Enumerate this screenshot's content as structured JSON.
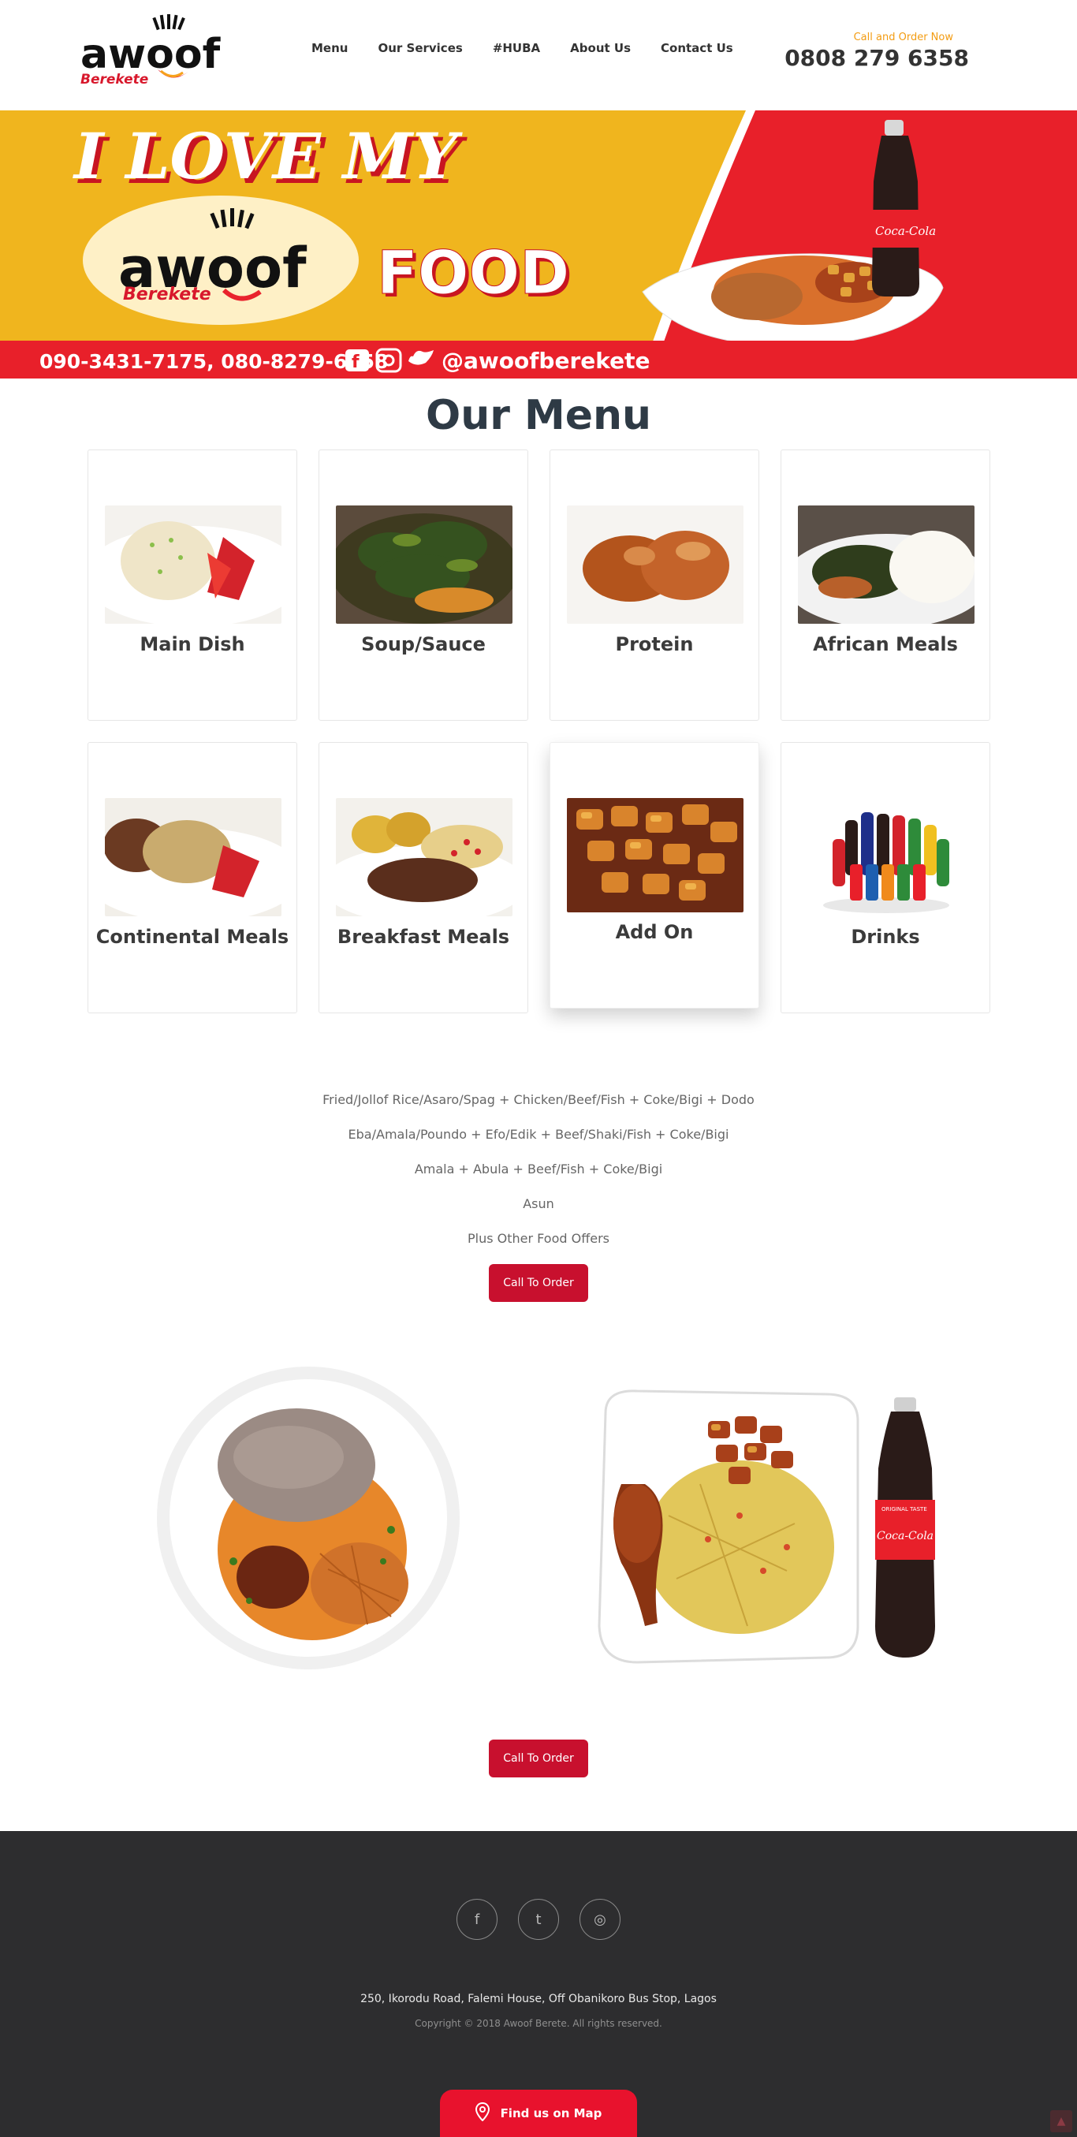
{
  "header": {
    "logo_text": "awoof",
    "logo_subtext": "Berekete",
    "nav": [
      "Menu",
      "Our Services",
      "#HUBA",
      "About Us",
      "Contact Us"
    ],
    "call_label": "Call and Order Now",
    "call_number": "0808 279 6358"
  },
  "banner": {
    "headline": "I LOVE MY",
    "logo_text": "awoof",
    "logo_subtext": "Berekete",
    "food_word": "FOOD",
    "phones": "090-3431-7175, 080-8279-6358",
    "handle": "@awoofberekete",
    "bottle_brand": "Coca-Cola",
    "colors": {
      "yellow": "#f0b51e",
      "red": "#e8202a",
      "white": "#ffffff"
    }
  },
  "menu": {
    "title": "Our Menu",
    "items": [
      {
        "label": "Main Dish",
        "icon": "rice-plate-photo"
      },
      {
        "label": "Soup/Sauce",
        "icon": "vegetable-soup-photo"
      },
      {
        "label": "Protein",
        "icon": "fried-chicken-photo"
      },
      {
        "label": "African Meals",
        "icon": "swallow-soup-photo"
      },
      {
        "label": "Continental Meals",
        "icon": "fried-rice-chicken-photo"
      },
      {
        "label": "Breakfast Meals",
        "icon": "yam-egg-photo"
      },
      {
        "label": "Add On",
        "icon": "dodo-photo"
      },
      {
        "label": "Drinks",
        "icon": "soft-drinks-photo"
      }
    ]
  },
  "offers": {
    "lines": [
      "Fried/Jollof Rice/Asaro/Spag + Chicken/Beef/Fish + Coke/Bigi + Dodo",
      "Eba/Amala/Poundo + Efo/Edik + Beef/Shaki/Fish + Coke/Bigi",
      "Amala + Abula + Beef/Fish +  Coke/Bigi",
      "Asun",
      "Plus Other Food Offers"
    ],
    "button": "Call To Order"
  },
  "gallery": {
    "button": "Call To Order",
    "bottle_brand": "Coca-Cola",
    "bottle_tag": "ORIGINAL TASTE"
  },
  "footer": {
    "social": [
      {
        "name": "facebook",
        "glyph": "f"
      },
      {
        "name": "twitter",
        "glyph": "t"
      },
      {
        "name": "instagram",
        "glyph": "◎"
      }
    ],
    "address": "250, Ikorodu Road, Falemi House, Off Obanikoro Bus Stop, Lagos",
    "copyright": "Copyright © 2018 Awoof Berete. All rights reserved.",
    "map_button": "Find us on Map",
    "scroll_top_icon": "▲"
  }
}
